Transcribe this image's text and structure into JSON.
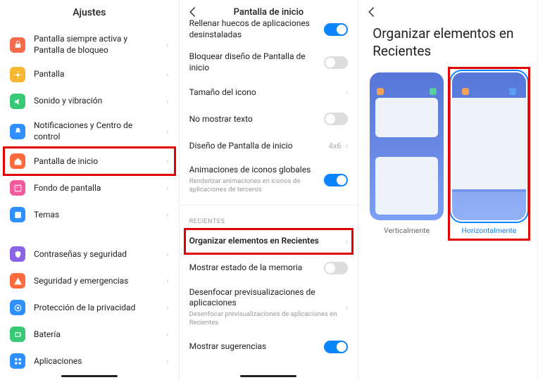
{
  "panel1": {
    "title": "Ajustes",
    "items": [
      {
        "label": "Pantalla siempre activa y Pantalla de bloqueo",
        "icon": "lock-icon",
        "color": "#f46b4d"
      },
      {
        "label": "Pantalla",
        "icon": "sun-icon",
        "color": "#f7b733"
      },
      {
        "label": "Sonido y vibración",
        "icon": "sound-icon",
        "color": "#38c976"
      },
      {
        "label": "Notificaciones y Centro de control",
        "icon": "bell-icon",
        "color": "#2f8fff"
      },
      {
        "label": "Pantalla de inicio",
        "icon": "home-icon",
        "color": "#ff6a3d",
        "highlighted": true
      },
      {
        "label": "Fondo de pantalla",
        "icon": "wallpaper-icon",
        "color": "#f25a9c"
      },
      {
        "label": "Temas",
        "icon": "themes-icon",
        "color": "#2f8fff"
      }
    ],
    "items2": [
      {
        "label": "Contraseñas y seguridad",
        "icon": "shield-icon",
        "color": "#8b63e6"
      },
      {
        "label": "Seguridad y emergencias",
        "icon": "warning-icon",
        "color": "#ff6a3d"
      },
      {
        "label": "Protección de la privacidad",
        "icon": "privacy-icon",
        "color": "#2f8fff"
      },
      {
        "label": "Batería",
        "icon": "battery-icon",
        "color": "#38c976"
      },
      {
        "label": "Aplicaciones",
        "icon": "apps-icon",
        "color": "#2f8fff"
      }
    ]
  },
  "panel2": {
    "title": "Pantalla de inicio",
    "rows": [
      {
        "label": "Rellenar huecos de aplicaciones desinstaladas",
        "type": "toggle",
        "on": true,
        "cutoff": true
      },
      {
        "label": "Bloquear diseño de Pantalla de inicio",
        "type": "toggle",
        "on": false
      },
      {
        "label": "Tamaño del icono",
        "type": "link"
      },
      {
        "label": "No mostrar texto",
        "type": "toggle",
        "on": false
      },
      {
        "label": "Diseño de Pantalla de inicio",
        "type": "value",
        "value": "4x6"
      },
      {
        "label": "Animaciones de iconos globales",
        "sub": "Renderizar animaciones en iconos de aplicaciones de terceros",
        "type": "toggle",
        "on": true
      }
    ],
    "section_header": "RECIENTES",
    "rows2": [
      {
        "label": "Organizar elementos en Recientes",
        "type": "link",
        "bold": true,
        "highlighted": true
      },
      {
        "label": "Mostrar estado de la memoria",
        "type": "toggle",
        "on": false
      },
      {
        "label": "Desenfocar previsualizaciones de aplicaciones",
        "sub": "Desenfocar previsualizaciones de aplicaciones en Recientes",
        "type": "link"
      },
      {
        "label": "Mostrar sugerencias",
        "type": "toggle",
        "on": true
      }
    ]
  },
  "panel3": {
    "title": "Organizar elementos en Recientes",
    "options": [
      {
        "label": "Verticalmente",
        "selected": false
      },
      {
        "label": "Horizontalmente",
        "selected": true,
        "highlighted": true
      }
    ]
  }
}
